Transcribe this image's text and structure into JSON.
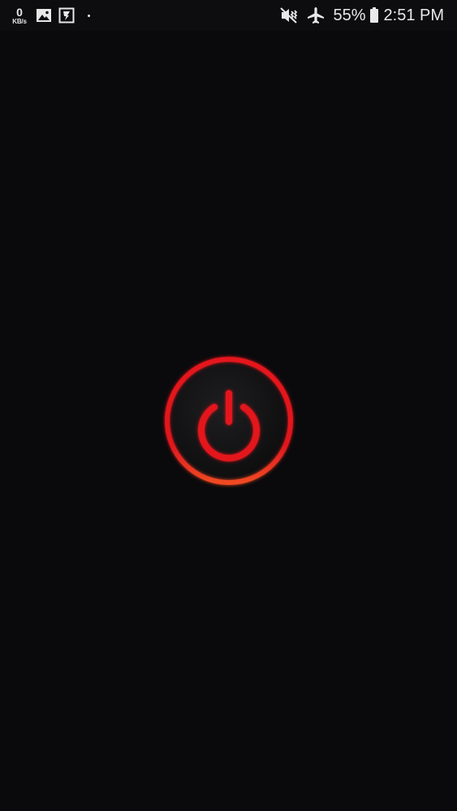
{
  "status_bar": {
    "net_speed_value": "0",
    "net_speed_unit": "KB/s",
    "left_icons": [
      "gallery-icon",
      "flashlight-app-icon",
      "notification-dot-icon"
    ],
    "right_icons": [
      "vibrate-mute-icon",
      "airplane-mode-icon",
      "battery-icon"
    ],
    "battery_percent": "55%",
    "time": "2:51 PM"
  },
  "colors": {
    "background": "#0a0a0c",
    "accent": "#e01a24",
    "accent_glow": "#ff5a2a",
    "button_fill": "#151516"
  },
  "main": {
    "power_button_icon": "power-icon"
  }
}
